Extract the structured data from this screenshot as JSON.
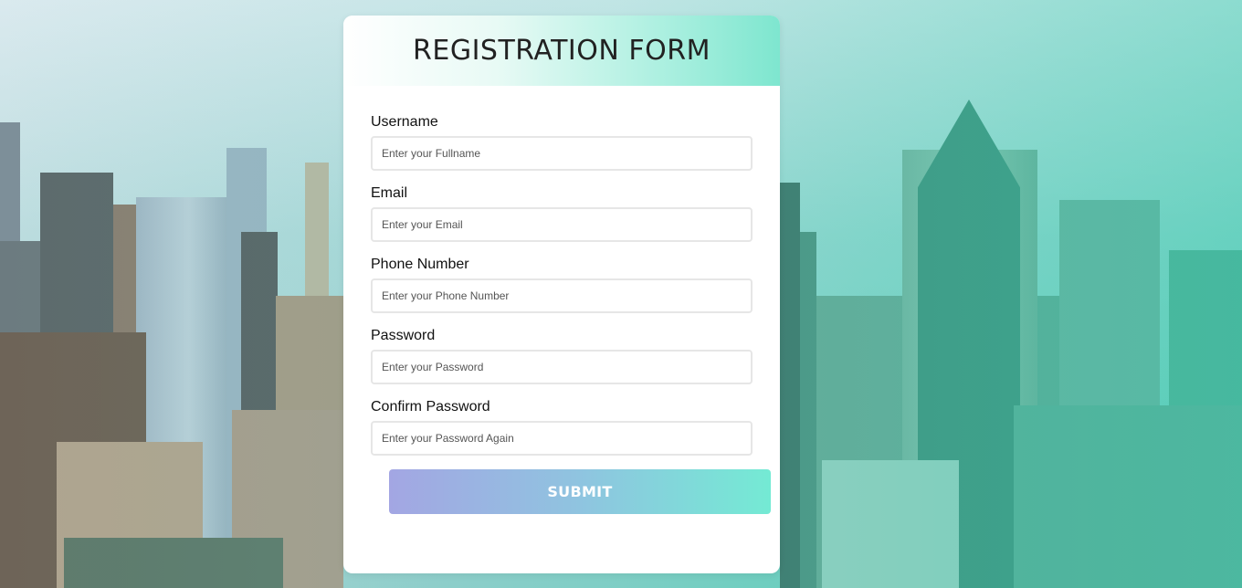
{
  "form": {
    "title": "REGISTRATION FORM",
    "fields": [
      {
        "label": "Username",
        "placeholder": "Enter your Fullname"
      },
      {
        "label": "Email",
        "placeholder": "Enter your Email"
      },
      {
        "label": "Phone Number",
        "placeholder": "Enter your Phone Number"
      },
      {
        "label": "Password",
        "placeholder": "Enter your Password"
      },
      {
        "label": "Confirm Password",
        "placeholder": "Enter your Password Again"
      }
    ],
    "submit_label": "SUBMIT"
  },
  "colors": {
    "header_gradient_end": "#7ee6cf",
    "button_gradient_start": "#a3a6e3",
    "button_gradient_end": "#74ead4",
    "background_tint": "#4fc9b4"
  }
}
